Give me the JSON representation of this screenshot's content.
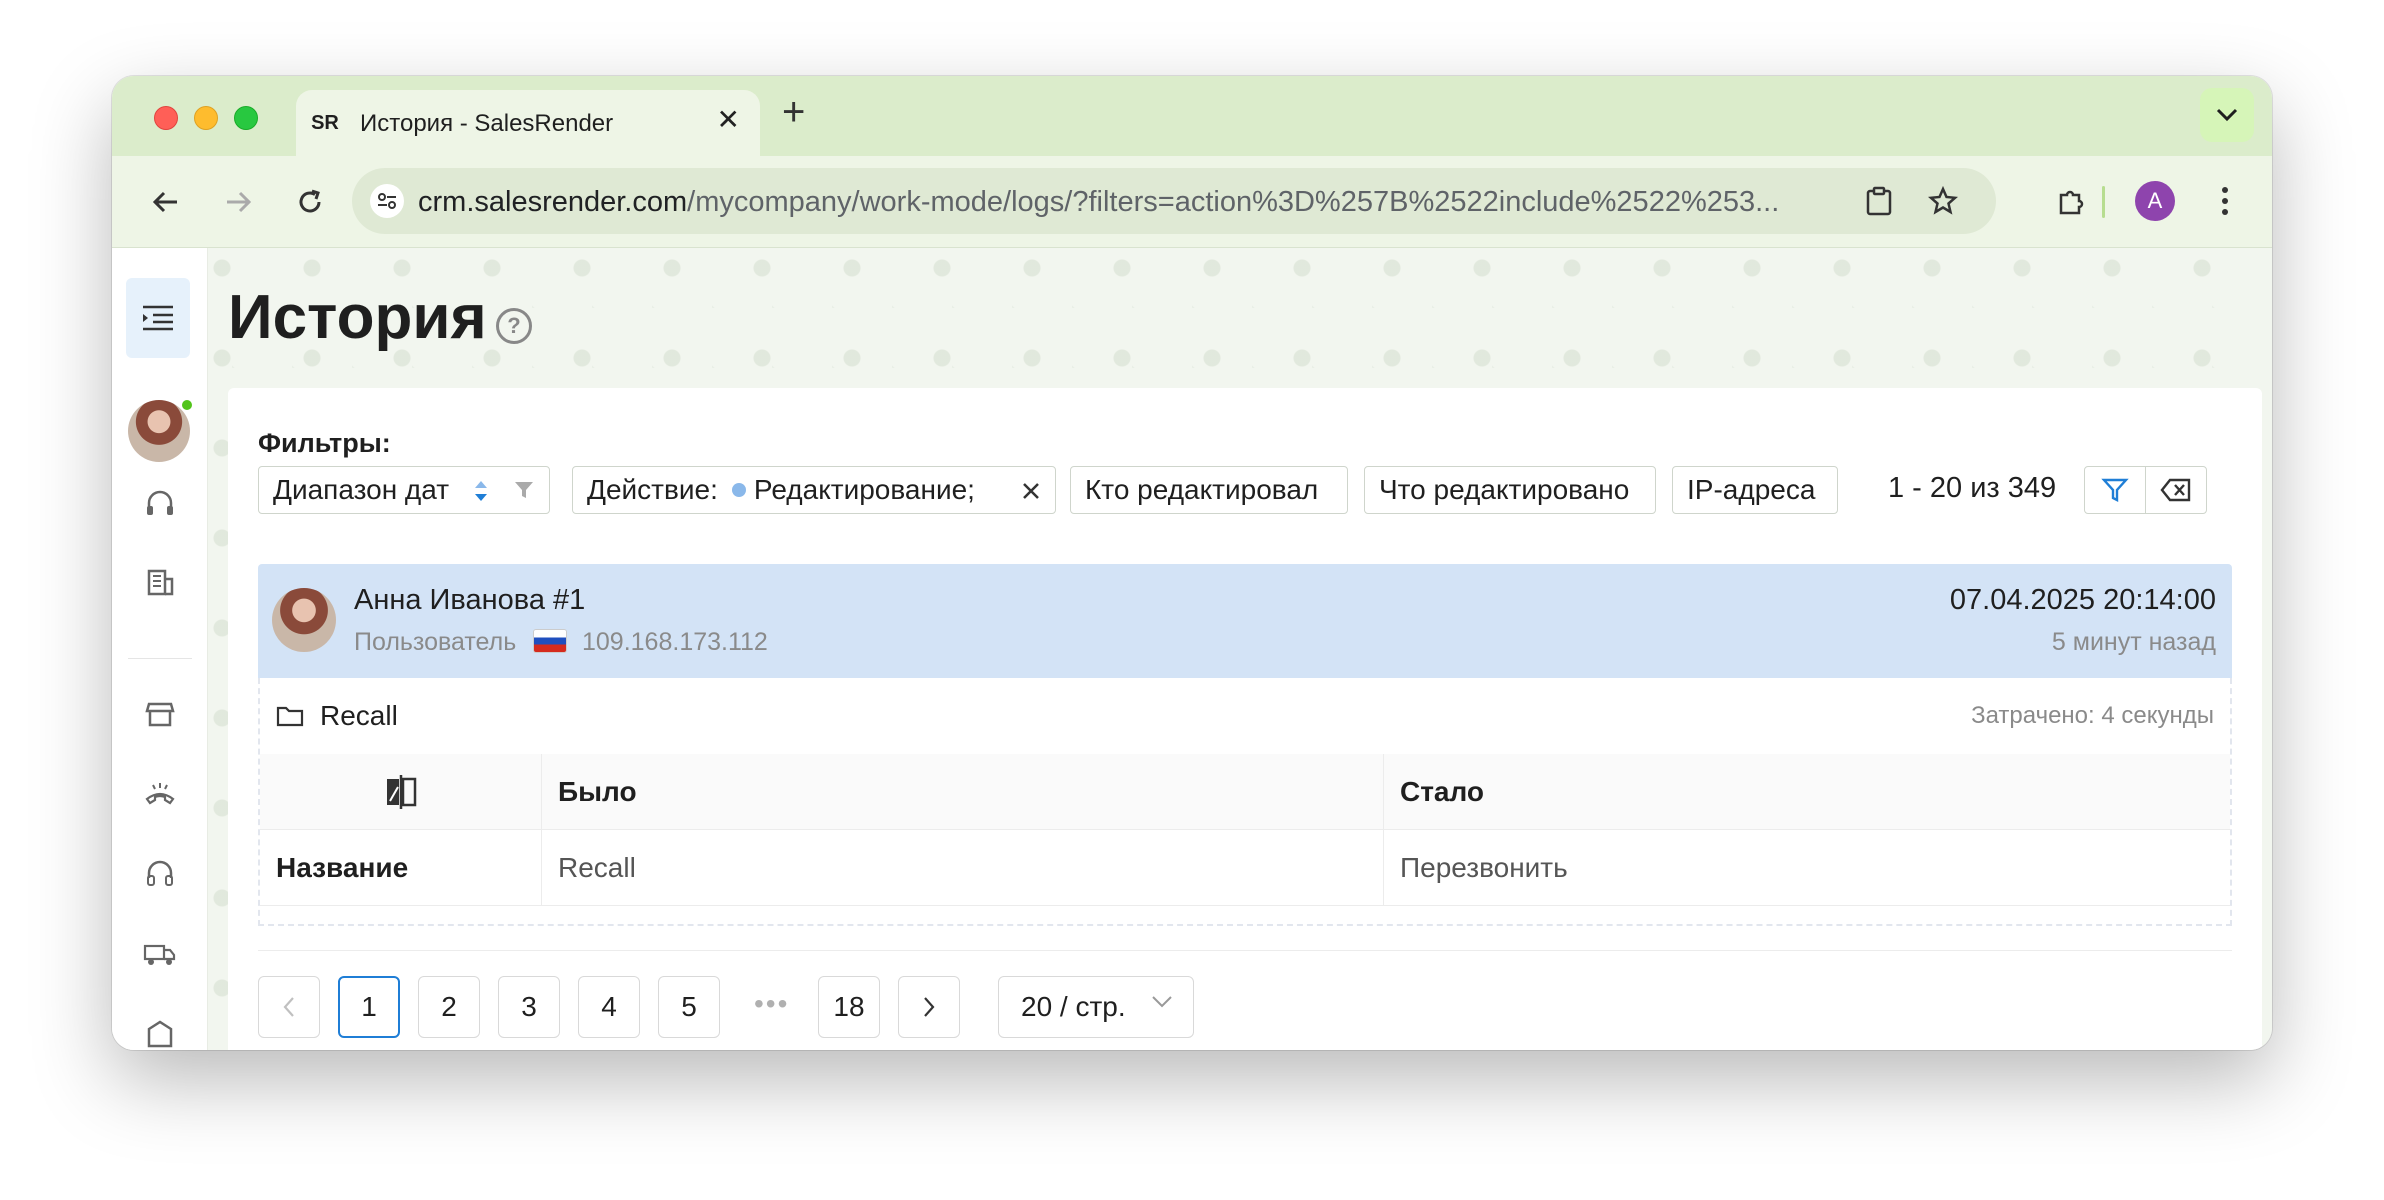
{
  "browser": {
    "tab_title": "История - SalesRender",
    "tab_favicon": "SR",
    "url_host": "crm.salesrender.com",
    "url_path": "/mycompany/work-mode/logs/?filters=action%3D%257B%2522include%2522%253...",
    "profile_initial": "A"
  },
  "page": {
    "title": "История"
  },
  "filters": {
    "label": "Фильтры:",
    "date_range_placeholder": "Диапазон дат",
    "action_label": "Действие:",
    "action_value": "Редактирование;",
    "who_edited": "Кто редактировал",
    "what_edited": "Что редактировано",
    "ip_addresses": "IP-адреса",
    "range_info": "1 - 20 из 349"
  },
  "entry": {
    "user_name": "Анна Иванова #1",
    "role": "Пользователь",
    "ip": "109.168.173.112",
    "datetime": "07.04.2025 20:14:00",
    "ago": "5 минут назад",
    "entity": "Recall",
    "spent": "Затрачено: 4 секунды",
    "table": {
      "col_was": "Было",
      "col_became": "Стало",
      "rows": [
        {
          "field": "Название",
          "was": "Recall",
          "became": "Перезвонить"
        }
      ]
    }
  },
  "pagination": {
    "prev": "<",
    "pages": [
      "1",
      "2",
      "3",
      "4",
      "5"
    ],
    "ellipsis": "•••",
    "last": "18",
    "next": ">",
    "page_size": "20 / стр.",
    "current": 1
  },
  "colors": {
    "accent": "#1f7ed6",
    "entry_header_bg": "#d3e3f6",
    "tabstrip_bg": "#dbeccb"
  }
}
